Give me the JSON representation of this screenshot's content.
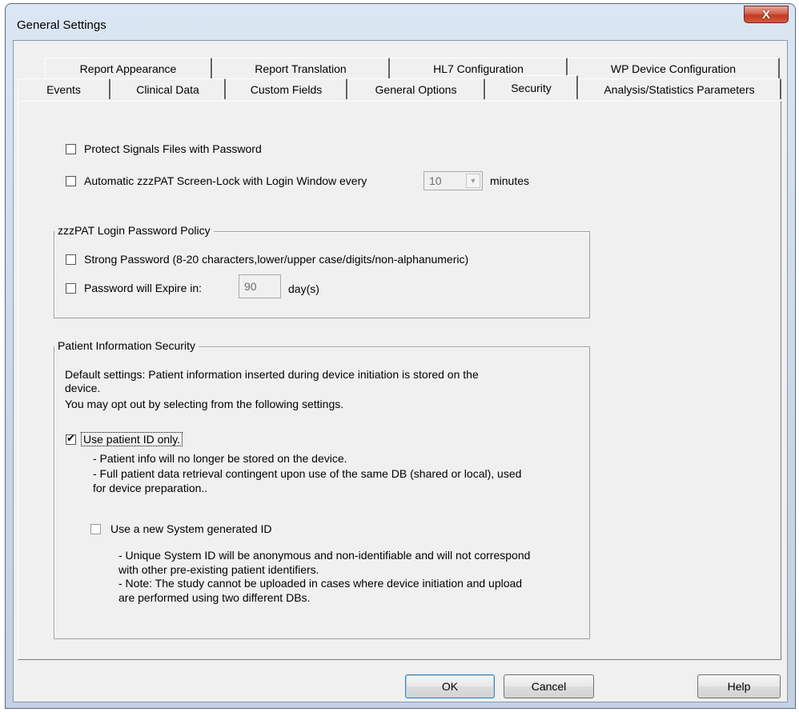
{
  "window": {
    "title": "General Settings",
    "close_symbol": "X"
  },
  "tabs": {
    "row_back": [
      "Report Appearance",
      "Report Translation",
      "HL7 Configuration",
      "WP Device Configuration"
    ],
    "row_front": [
      "Events",
      "Clinical Data",
      "Custom Fields",
      "General Options",
      "Security",
      "Analysis/Statistics Parameters"
    ],
    "active": "Security"
  },
  "security": {
    "protect_signals": {
      "label": "Protect Signals Files with Password",
      "checked": false
    },
    "screen_lock": {
      "label": "Automatic zzzPAT Screen-Lock with Login Window every",
      "checked": false,
      "interval": "10",
      "unit": "minutes"
    },
    "login_policy": {
      "title": "zzzPAT Login Password Policy",
      "strong_password": {
        "label": "Strong Password (8-20 characters,lower/upper case/digits/non-alphanumeric)",
        "checked": false
      },
      "expire": {
        "label": "Password will Expire in:",
        "checked": false,
        "days": "90",
        "unit": "day(s)"
      }
    },
    "patient_info": {
      "title": "Patient Information Security",
      "description_line1": "Default settings: Patient information inserted during device initiation is stored on the",
      "description_line2": "device.",
      "description_line3": "You may opt out by selecting from the following settings.",
      "use_patient_id": {
        "label": "Use patient ID only.",
        "checked": true
      },
      "note1": "- Patient info will no longer be stored on the device.",
      "note2_line1": "- Full patient data retrieval contingent upon use of the same DB (shared or local), used",
      "note2_line2": "for device preparation..",
      "system_id": {
        "label": "Use a new System generated ID",
        "checked": false
      },
      "sysnote1_line1": "- Unique System ID will be anonymous and non-identifiable and will not correspond",
      "sysnote1_line2": "with other pre-existing patient identifiers.",
      "sysnote2_line1": "- Note: The study cannot be uploaded in cases where device initiation and upload",
      "sysnote2_line2": "are performed using two different DBs."
    }
  },
  "buttons": {
    "ok": "OK",
    "cancel": "Cancel",
    "help": "Help"
  }
}
